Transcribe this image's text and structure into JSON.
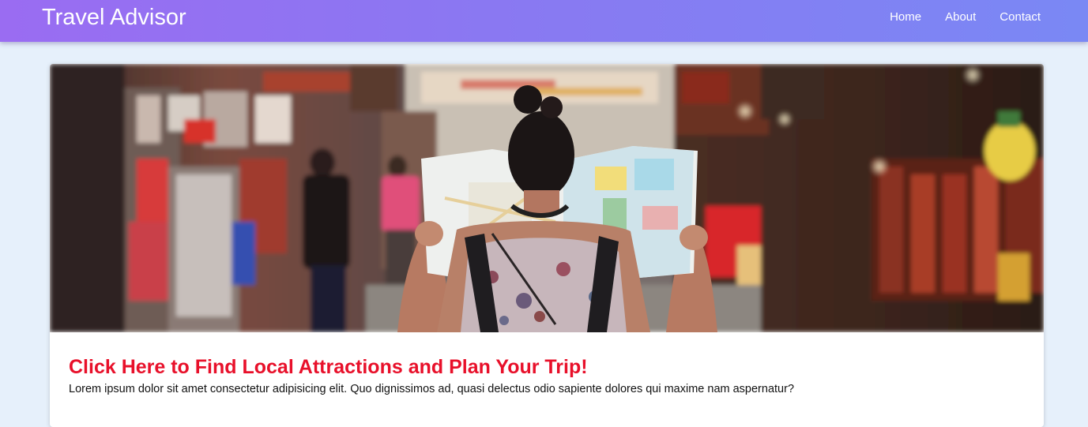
{
  "header": {
    "brand": "Travel Advisor",
    "nav": [
      {
        "label": "Home"
      },
      {
        "label": "About"
      },
      {
        "label": "Contact"
      }
    ]
  },
  "card": {
    "title": "Click Here to Find Local Attractions and Plan Your Trip!",
    "text": "Lorem ipsum dolor sit amet consectetur adipisicing elit. Quo dignissimos ad, quasi delectus odio sapiente dolores qui maxime nam aspernatur?"
  },
  "colors": {
    "nav_gradient_start": "#9a6cf2",
    "nav_gradient_end": "#7a88f4",
    "page_background": "#e6f0fb",
    "title_red": "#e8102a"
  }
}
